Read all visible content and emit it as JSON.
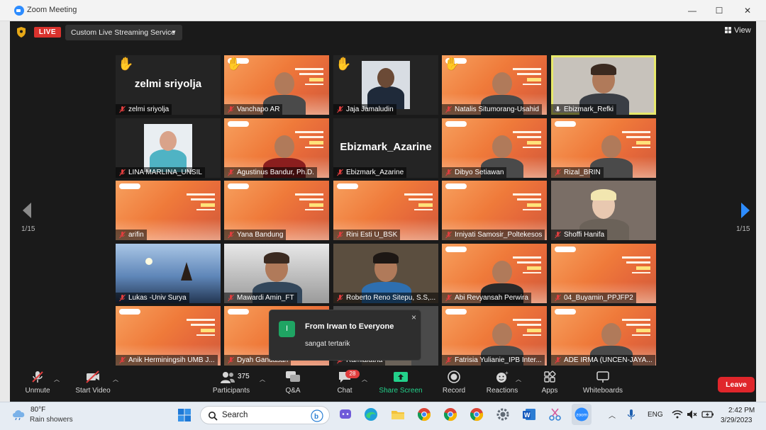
{
  "window": {
    "title": "Zoom Meeting"
  },
  "top_bar": {
    "live_label": "LIVE",
    "stream_service": "Custom Live Streaming Service",
    "view_label": "View"
  },
  "pager": {
    "left_label": "1/15",
    "right_label": "1/15"
  },
  "participants": [
    {
      "name": "zelmi sriyolja",
      "video": "off",
      "big_name": "zelmi sriyolja",
      "hand": true
    },
    {
      "name": "Vanchapo AR",
      "video": "slide",
      "hand": true
    },
    {
      "name": "Jaja Jamaludin",
      "video": "photo",
      "hand": true
    },
    {
      "name": "Natalis Situmorang-Usahid",
      "video": "slide",
      "hand": true
    },
    {
      "name": "Ebizmark_Refki",
      "video": "camera",
      "active_speaker": true
    },
    {
      "name": "LINA MARLINA_UNSIL",
      "video": "photo"
    },
    {
      "name": "Agustinus Bandur, Ph.D.",
      "video": "slide"
    },
    {
      "name": "Ebizmark_Azarine",
      "video": "off",
      "big_name": "Ebizmark_Azarine"
    },
    {
      "name": "Dibyo Setiawan",
      "video": "slide"
    },
    {
      "name": "Rizal_BRIN",
      "video": "slide"
    },
    {
      "name": "arifin",
      "video": "slide"
    },
    {
      "name": "Yana Bandung",
      "video": "slide"
    },
    {
      "name": "Rini Esti U_BSK",
      "video": "slide"
    },
    {
      "name": "Irniyati Samosir_Poltekesos",
      "video": "slide"
    },
    {
      "name": "Shoffi Hanifa",
      "video": "camera"
    },
    {
      "name": "Lukas -Univ Surya",
      "video": "painting"
    },
    {
      "name": "Mawardi Amin_FT",
      "video": "camera"
    },
    {
      "name": "Roberto Reno Sitepu, S.S,...",
      "video": "camera"
    },
    {
      "name": "Abi Revyansah Perwira",
      "video": "slide"
    },
    {
      "name": "04_Buyamin_PPJFP2",
      "video": "slide"
    },
    {
      "name": "Anik Herminingsih UMB J...",
      "video": "slide"
    },
    {
      "name": "Dyah Gandasari",
      "video": "slide"
    },
    {
      "name": "Ramlafatna",
      "video": "camera"
    },
    {
      "name": "Fatrisia Yulianie_IPB Inter...",
      "video": "slide"
    },
    {
      "name": "ADE IRMA (UNCEN-JAYA...",
      "video": "slide"
    }
  ],
  "chat_toast": {
    "avatar_letter": "I",
    "from": "From Irwan to Everyone",
    "message": "sangat tertarik",
    "close": "×"
  },
  "toolbar": {
    "unmute": "Unmute",
    "start_video": "Start Video",
    "participants_count": "375",
    "participants": "Participants",
    "qa": "Q&A",
    "chat": "Chat",
    "chat_badge": "28",
    "share_screen": "Share Screen",
    "record": "Record",
    "reactions": "Reactions",
    "apps": "Apps",
    "whiteboards": "Whiteboards",
    "leave": "Leave"
  },
  "taskbar": {
    "weather_temp": "80°F",
    "weather_desc": "Rain showers",
    "search_placeholder": "Search",
    "language": "ENG",
    "time": "2:42 PM",
    "date": "3/29/2023"
  },
  "colors": {
    "zoom_blue": "#2d8cff",
    "live_red": "#d9322d",
    "leave_red": "#e0262b",
    "active_outline": "#e7e86a",
    "share_green": "#23d18b",
    "slide_orange": "#ef7a3a"
  }
}
